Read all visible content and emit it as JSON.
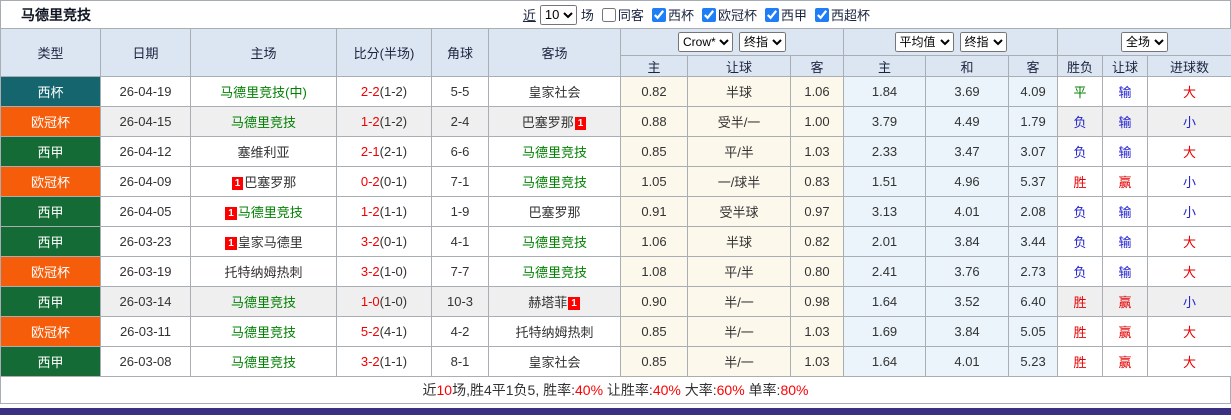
{
  "title": "马德里竞技",
  "toolbar": {
    "recent_label": "近",
    "recent_value": "10",
    "unit_label": "场",
    "checkboxes": [
      {
        "label": "同客",
        "checked": false
      },
      {
        "label": "西杯",
        "checked": true
      },
      {
        "label": "欧冠杯",
        "checked": true
      },
      {
        "label": "西甲",
        "checked": true
      },
      {
        "label": "西超杯",
        "checked": true
      }
    ]
  },
  "header": {
    "static_cols": [
      "类型",
      "日期",
      "主场",
      "比分(半场)",
      "角球",
      "客场"
    ],
    "group1": {
      "selects": [
        "Crow*",
        "终指"
      ],
      "cols": [
        "主",
        "让球",
        "客"
      ]
    },
    "group2": {
      "selects": [
        "平均值",
        "终指"
      ],
      "cols": [
        "主",
        "和",
        "客"
      ]
    },
    "group3": {
      "selects": [
        "全场"
      ],
      "cols": [
        "胜负",
        "让球",
        "进球数"
      ]
    }
  },
  "colors": {
    "competition": {
      "西杯": "#15656e",
      "欧冠杯": "#f55d0a",
      "西甲": "#156b35"
    },
    "team_green": "#008000",
    "score_red": "#f00000",
    "result_red": "#e60000",
    "result_blue": "#2222cc",
    "result_green": "#008000",
    "bottom_bar": "#3a3182"
  },
  "rows": [
    {
      "type": "西杯",
      "date": "26-04-19",
      "shaded": false,
      "home": {
        "name": "马德里竞技(中)",
        "green": true
      },
      "score": "2-2",
      "half": "(1-2)",
      "corner": "5-5",
      "away": {
        "name": "皇家社会",
        "green": false
      },
      "crow": [
        "0.82",
        "半球",
        "1.06"
      ],
      "avg": [
        "1.84",
        "3.69",
        "4.09"
      ],
      "result": [
        {
          "t": "平",
          "c": "green"
        },
        {
          "t": "输",
          "c": "blue"
        },
        {
          "t": "大",
          "c": "red"
        }
      ]
    },
    {
      "type": "欧冠杯",
      "date": "26-04-15",
      "shaded": true,
      "home": {
        "name": "马德里竞技",
        "green": true
      },
      "score": "1-2",
      "half": "(1-2)",
      "corner": "2-4",
      "away": {
        "name": "巴塞罗那",
        "green": false,
        "badge": "1",
        "badge_pos": "right"
      },
      "crow": [
        "0.88",
        "受半/一",
        "1.00"
      ],
      "avg": [
        "3.79",
        "4.49",
        "1.79"
      ],
      "result": [
        {
          "t": "负",
          "c": "blue"
        },
        {
          "t": "输",
          "c": "blue"
        },
        {
          "t": "小",
          "c": "blue"
        }
      ]
    },
    {
      "type": "西甲",
      "date": "26-04-12",
      "shaded": false,
      "home": {
        "name": "塞维利亚",
        "green": false
      },
      "score": "2-1",
      "half": "(2-1)",
      "corner": "6-6",
      "away": {
        "name": "马德里竞技",
        "green": true
      },
      "crow": [
        "0.85",
        "平/半",
        "1.03"
      ],
      "avg": [
        "2.33",
        "3.47",
        "3.07"
      ],
      "result": [
        {
          "t": "负",
          "c": "blue"
        },
        {
          "t": "输",
          "c": "blue"
        },
        {
          "t": "大",
          "c": "red"
        }
      ]
    },
    {
      "type": "欧冠杯",
      "date": "26-04-09",
      "shaded": false,
      "home": {
        "name": "巴塞罗那",
        "green": false,
        "badge": "1",
        "badge_pos": "left"
      },
      "score": "0-2",
      "half": "(0-1)",
      "corner": "7-1",
      "away": {
        "name": "马德里竞技",
        "green": true
      },
      "crow": [
        "1.05",
        "一/球半",
        "0.83"
      ],
      "avg": [
        "1.51",
        "4.96",
        "5.37"
      ],
      "result": [
        {
          "t": "胜",
          "c": "red"
        },
        {
          "t": "赢",
          "c": "red"
        },
        {
          "t": "小",
          "c": "blue"
        }
      ]
    },
    {
      "type": "西甲",
      "date": "26-04-05",
      "shaded": false,
      "home": {
        "name": "马德里竞技",
        "green": true,
        "badge": "1",
        "badge_pos": "left"
      },
      "score": "1-2",
      "half": "(1-1)",
      "corner": "1-9",
      "away": {
        "name": "巴塞罗那",
        "green": false
      },
      "crow": [
        "0.91",
        "受半球",
        "0.97"
      ],
      "avg": [
        "3.13",
        "4.01",
        "2.08"
      ],
      "result": [
        {
          "t": "负",
          "c": "blue"
        },
        {
          "t": "输",
          "c": "blue"
        },
        {
          "t": "小",
          "c": "blue"
        }
      ]
    },
    {
      "type": "西甲",
      "date": "26-03-23",
      "shaded": false,
      "home": {
        "name": "皇家马德里",
        "green": false,
        "badge": "1",
        "badge_pos": "left"
      },
      "score": "3-2",
      "half": "(0-1)",
      "corner": "4-1",
      "away": {
        "name": "马德里竞技",
        "green": true
      },
      "crow": [
        "1.06",
        "半球",
        "0.82"
      ],
      "avg": [
        "2.01",
        "3.84",
        "3.44"
      ],
      "result": [
        {
          "t": "负",
          "c": "blue"
        },
        {
          "t": "输",
          "c": "blue"
        },
        {
          "t": "大",
          "c": "red"
        }
      ]
    },
    {
      "type": "欧冠杯",
      "date": "26-03-19",
      "shaded": false,
      "home": {
        "name": "托特纳姆热刺",
        "green": false
      },
      "score": "3-2",
      "half": "(1-0)",
      "corner": "7-7",
      "away": {
        "name": "马德里竞技",
        "green": true
      },
      "crow": [
        "1.08",
        "平/半",
        "0.80"
      ],
      "avg": [
        "2.41",
        "3.76",
        "2.73"
      ],
      "result": [
        {
          "t": "负",
          "c": "blue"
        },
        {
          "t": "输",
          "c": "blue"
        },
        {
          "t": "大",
          "c": "red"
        }
      ]
    },
    {
      "type": "西甲",
      "date": "26-03-14",
      "shaded": true,
      "home": {
        "name": "马德里竞技",
        "green": true
      },
      "score": "1-0",
      "half": "(1-0)",
      "corner": "10-3",
      "away": {
        "name": "赫塔菲",
        "green": false,
        "badge": "1",
        "badge_pos": "right"
      },
      "crow": [
        "0.90",
        "半/一",
        "0.98"
      ],
      "avg": [
        "1.64",
        "3.52",
        "6.40"
      ],
      "result": [
        {
          "t": "胜",
          "c": "red"
        },
        {
          "t": "赢",
          "c": "red"
        },
        {
          "t": "小",
          "c": "blue"
        }
      ]
    },
    {
      "type": "欧冠杯",
      "date": "26-03-11",
      "shaded": false,
      "home": {
        "name": "马德里竞技",
        "green": true
      },
      "score": "5-2",
      "half": "(4-1)",
      "corner": "4-2",
      "away": {
        "name": "托特纳姆热刺",
        "green": false
      },
      "crow": [
        "0.85",
        "半/一",
        "1.03"
      ],
      "avg": [
        "1.69",
        "3.84",
        "5.05"
      ],
      "result": [
        {
          "t": "胜",
          "c": "red"
        },
        {
          "t": "赢",
          "c": "red"
        },
        {
          "t": "大",
          "c": "red"
        }
      ]
    },
    {
      "type": "西甲",
      "date": "26-03-08",
      "shaded": false,
      "home": {
        "name": "马德里竞技",
        "green": true
      },
      "score": "3-2",
      "half": "(1-1)",
      "corner": "8-1",
      "away": {
        "name": "皇家社会",
        "green": false
      },
      "crow": [
        "0.85",
        "半/一",
        "1.03"
      ],
      "avg": [
        "1.64",
        "4.01",
        "5.23"
      ],
      "result": [
        {
          "t": "胜",
          "c": "red"
        },
        {
          "t": "赢",
          "c": "red"
        },
        {
          "t": "大",
          "c": "red"
        }
      ]
    }
  ],
  "summary": {
    "parts": [
      {
        "t": "近"
      },
      {
        "t": "10",
        "red": true
      },
      {
        "t": "场,胜4平1负5, 胜率:"
      },
      {
        "t": "40%",
        "red": true
      },
      {
        "t": " 让胜率:"
      },
      {
        "t": "40%",
        "red": true
      },
      {
        "t": " 大率:"
      },
      {
        "t": "60%",
        "red": true
      },
      {
        "t": " 单率:"
      },
      {
        "t": "80%",
        "red": true
      }
    ]
  }
}
